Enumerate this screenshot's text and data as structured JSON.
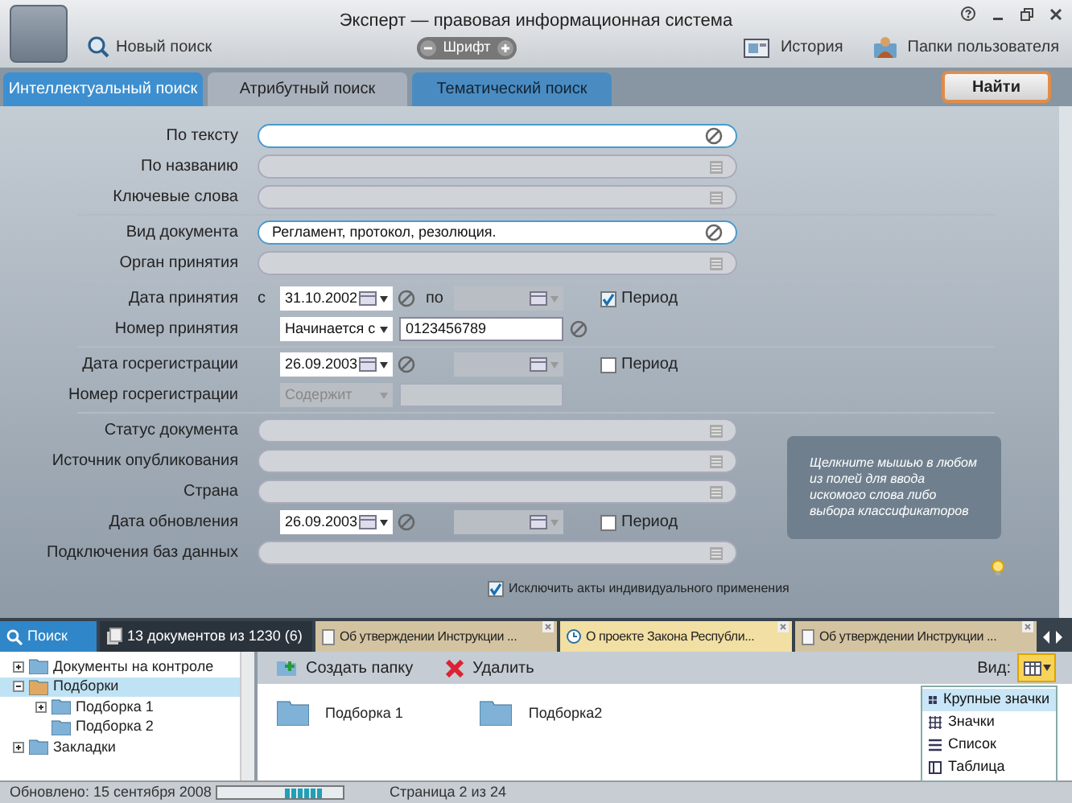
{
  "window": {
    "title": "Эксперт — правовая информационная система"
  },
  "toolbar": {
    "new_search": "Новый поиск",
    "font": "Шрифт",
    "history": "История",
    "user_folders": "Папки пользователя"
  },
  "tabs": [
    {
      "label": "Интеллектуальный поиск",
      "selected": true
    },
    {
      "label": "Атрибутный поиск",
      "selected": false
    },
    {
      "label": "Тематический поиск",
      "selected": false
    }
  ],
  "find_button": "Найти",
  "form": {
    "groups": [
      [
        {
          "kind": "text",
          "label": "По тексту",
          "editable": true
        },
        {
          "kind": "text",
          "label": "По названию",
          "editable": false
        },
        {
          "kind": "text",
          "label": "Ключевые слова",
          "editable": false
        }
      ],
      [
        {
          "kind": "text",
          "label": "Вид документа",
          "value": "Регламент, протокол, резолюция.",
          "editable": true
        },
        {
          "kind": "text",
          "label": "Орган принятия",
          "editable": false
        }
      ],
      [
        {
          "kind": "date",
          "label": "Дата принятия",
          "from_label": "с",
          "from": "31.10.2002",
          "to_label": "по",
          "period": {
            "label": "Период",
            "checked": true
          }
        },
        {
          "kind": "number",
          "label": "Номер принятия",
          "mode": "Начинается с",
          "value": "0123456789",
          "enabled": true
        }
      ],
      [
        {
          "kind": "date",
          "label": "Дата госрегистрации",
          "from": "26.09.2003",
          "period": {
            "label": "Период",
            "checked": false
          }
        },
        {
          "kind": "number",
          "label": "Номер госрегистрации",
          "mode": "Содержит",
          "enabled": false
        }
      ],
      [
        {
          "kind": "text",
          "label": "Статус документа",
          "editable": false
        },
        {
          "kind": "text",
          "label": "Источник опубликования",
          "editable": false
        },
        {
          "kind": "text",
          "label": "Страна",
          "editable": false
        },
        {
          "kind": "date",
          "label": "Дата обновления",
          "from": "26.09.2003",
          "period": {
            "label": "Период",
            "checked": false
          }
        },
        {
          "kind": "text",
          "label": "Подключения баз данных",
          "editable": false
        }
      ]
    ],
    "exclude": {
      "label": "Исключить акты индивидуального применения",
      "checked": true
    }
  },
  "hint": "Щелкните мышью в любом из полей для ввода искомого слова либо выбора классификаторов",
  "doc_tabs": [
    {
      "kind": "search",
      "label": "Поиск",
      "selected": true
    },
    {
      "kind": "list",
      "label": "13 документов из 1230 (6)",
      "selected": false
    },
    {
      "kind": "document",
      "label": "Об утверждении Инструкции ...",
      "selected": false
    },
    {
      "kind": "project",
      "label": "О проекте Закона Республи...",
      "selected": true
    },
    {
      "kind": "document",
      "label": "Об утверждении Инструкции ...",
      "selected": false
    }
  ],
  "tree": [
    {
      "label": "Документы на контроле",
      "expanded": false,
      "selected": false
    },
    {
      "label": "Подборки",
      "expanded": true,
      "selected": true,
      "children": [
        {
          "label": "Подборка 1",
          "expanded": false,
          "selected": false
        },
        {
          "label": "Подборка 2",
          "selected": false
        }
      ]
    },
    {
      "label": "Закладки",
      "expanded": false,
      "selected": false
    }
  ],
  "folder_toolbar": {
    "create": "Создать папку",
    "delete": "Удалить",
    "view_label": "Вид:"
  },
  "folders": [
    "Подборка 1",
    "Подборка2"
  ],
  "view_menu": [
    {
      "label": "Крупные значки",
      "selected": true
    },
    {
      "label": "Значки",
      "selected": false
    },
    {
      "label": "Список",
      "selected": false
    },
    {
      "label": "Таблица",
      "selected": false
    }
  ],
  "status_bar": {
    "updated": "Обновлено: 15 сентября 2008",
    "page": "Страница 2 из 24"
  }
}
